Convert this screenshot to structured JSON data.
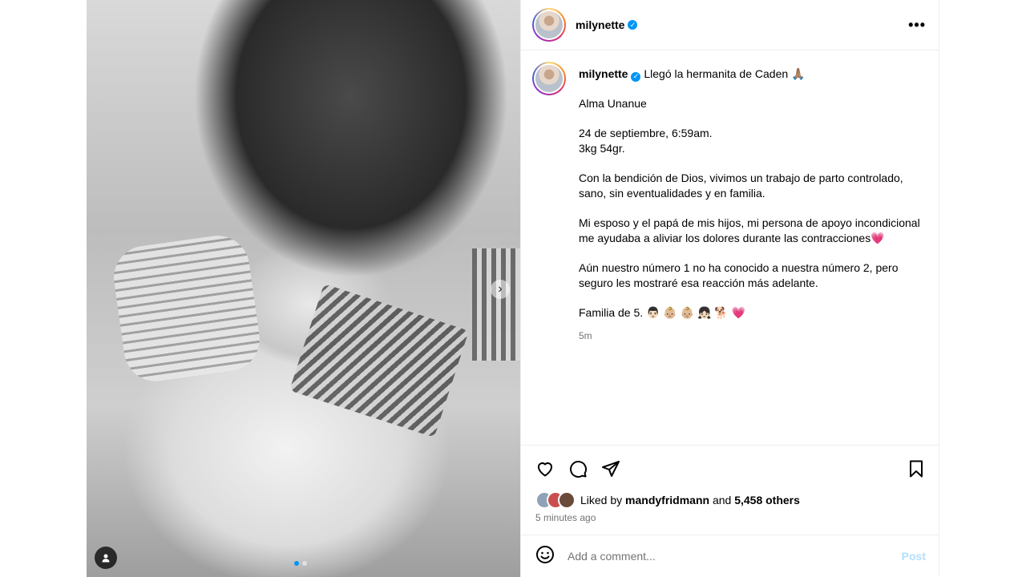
{
  "post": {
    "carousel": {
      "slide_count": 2,
      "active_slide": 1
    },
    "header": {
      "username": "milynette",
      "more_label": "•••"
    },
    "caption": {
      "username": "milynette",
      "first_line": "Llegó la hermanita de Caden 🙏🏽",
      "paragraphs": [
        "Alma Unanue",
        "24 de septiembre, 6:59am.",
        "3kg 54gr.",
        "Con la bendición de Dios, vivimos un trabajo de parto controlado, sano, sin eventualidades y en familia.",
        "Mi esposo y el papá de mis hijos, mi persona de apoyo incondicional me ayudaba a aliviar los dolores durante las contracciones💗",
        "Aún nuestro número 1 no ha conocido a nuestra número 2, pero seguro les mostraré esa reacción más adelante.",
        "Familia de 5. 👨🏻 👶🏼 👶🏼 👧🏻 🐕 💗"
      ],
      "time_ago": "5m"
    },
    "likes": {
      "prefix": "Liked by",
      "liker": "mandyfridmann",
      "and": "and",
      "others": "5,458 others"
    },
    "posted_time": "5 minutes ago",
    "comment": {
      "placeholder": "Add a comment...",
      "post_label": "Post"
    },
    "colors": {
      "accent": "#0095f6",
      "post_disabled": "#b2dffc",
      "muted": "#737373"
    }
  }
}
